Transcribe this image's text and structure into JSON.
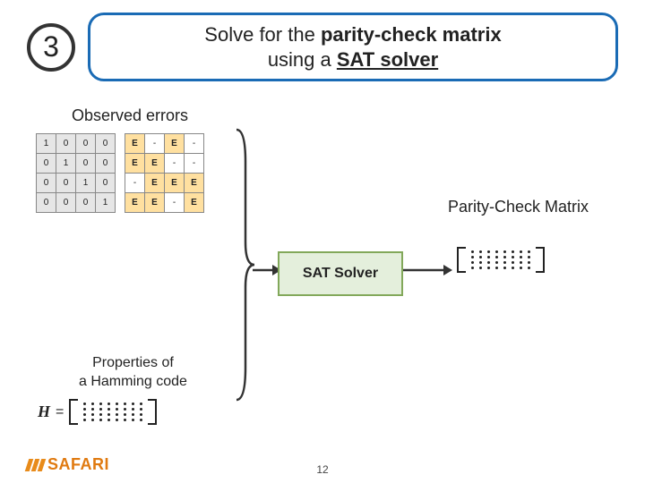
{
  "step_number": "3",
  "title_pre": "Solve for the ",
  "title_bold1": "parity-check matrix",
  "title_mid": "using a ",
  "title_bold2": "SAT solver",
  "observed_label": "Observed errors",
  "properties_label_l1": "Properties of",
  "properties_label_l2": "a Hamming code",
  "pcm_label": "Parity-Check Matrix",
  "sat_label": "SAT Solver",
  "H_symbol": "H",
  "equals": "=",
  "page_number": "12",
  "logo_text": "SAFARI",
  "identity_rows": [
    [
      "1",
      "0",
      "0",
      "0"
    ],
    [
      "0",
      "1",
      "0",
      "0"
    ],
    [
      "0",
      "0",
      "1",
      "0"
    ],
    [
      "0",
      "0",
      "0",
      "1"
    ]
  ],
  "error_rows": [
    [
      "E",
      "-",
      "E",
      "-"
    ],
    [
      "E",
      "E",
      "-",
      "-"
    ],
    [
      "-",
      "E",
      "E",
      "E"
    ],
    [
      "E",
      "E",
      "-",
      "E"
    ]
  ]
}
